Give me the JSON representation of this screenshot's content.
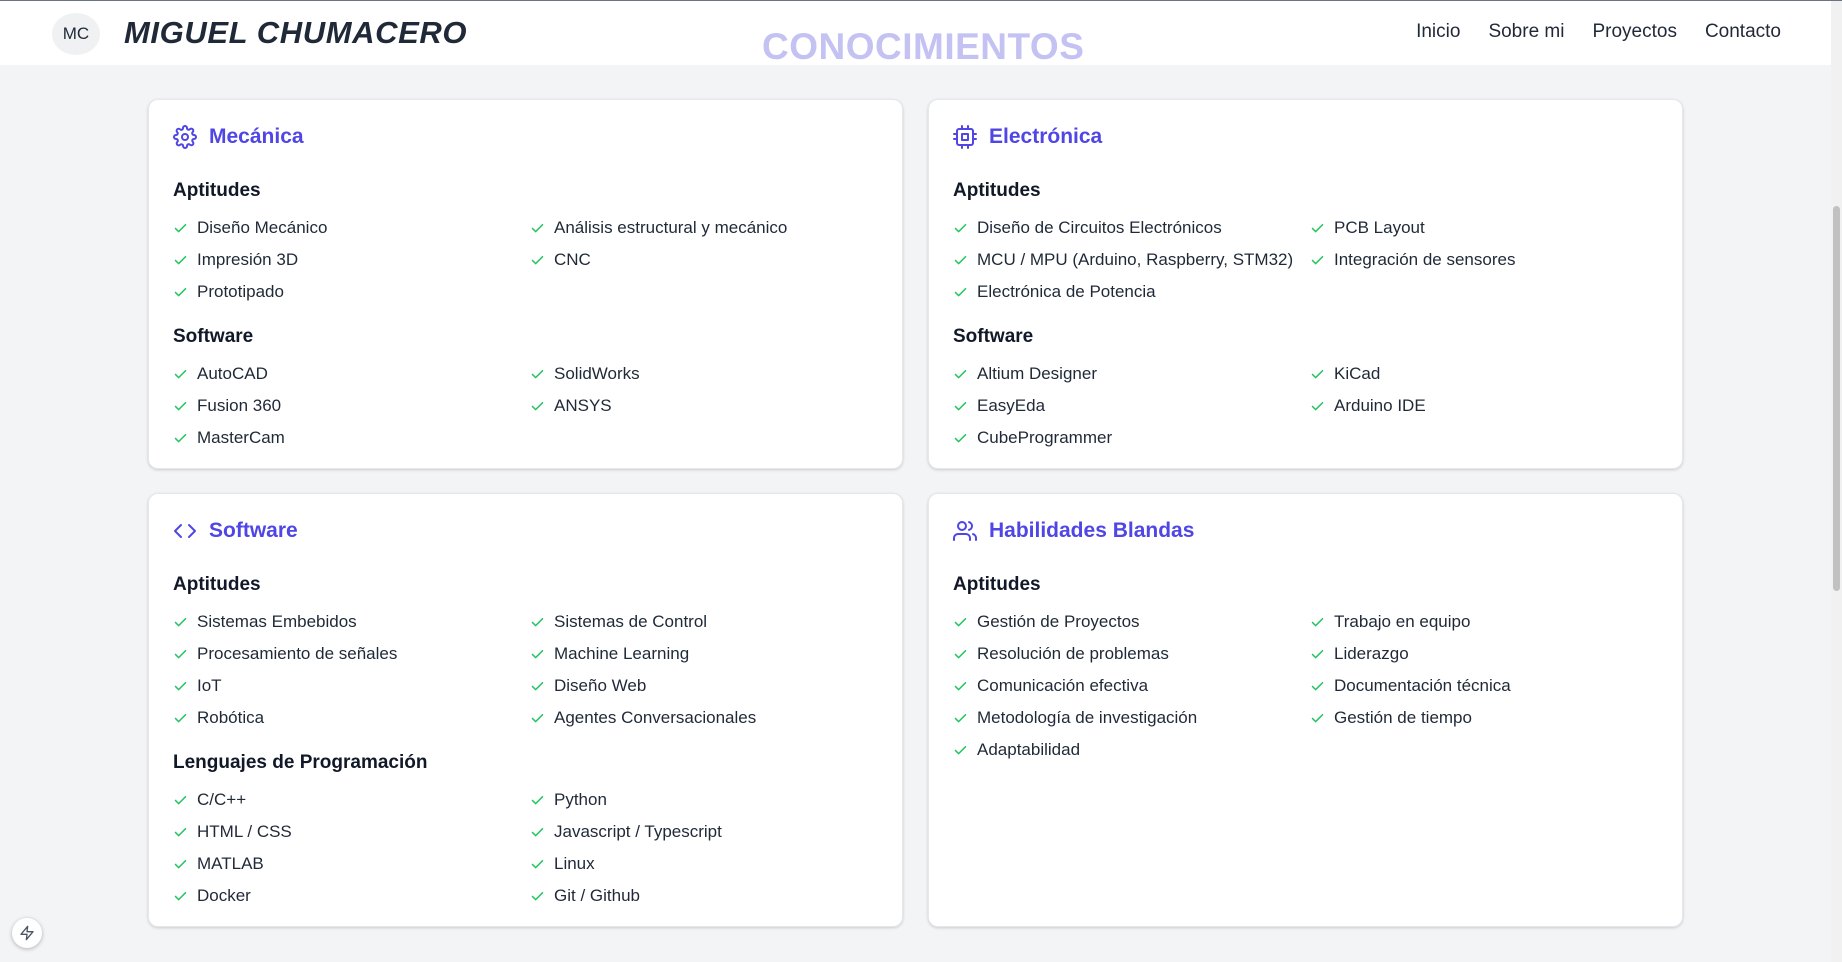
{
  "header": {
    "avatar_initials": "MC",
    "brand": "MIGUEL CHUMACERO",
    "section_title": "CONOCIMIENTOS",
    "nav": [
      "Inicio",
      "Sobre mi",
      "Proyectos",
      "Contacto"
    ]
  },
  "colors": {
    "accent": "#4f46e5",
    "check": "#22c55e",
    "section_title": "#c4c2f2",
    "background": "#f3f4f6"
  },
  "cards": {
    "mecanica": {
      "title": "Mecánica",
      "icon": "gear-icon",
      "groups": [
        {
          "title": "Aptitudes",
          "items": [
            "Diseño Mecánico",
            "Análisis estructural y mecánico",
            "Impresión 3D",
            "CNC",
            "Prototipado"
          ]
        },
        {
          "title": "Software",
          "items": [
            "AutoCAD",
            "SolidWorks",
            "Fusion 360",
            "ANSYS",
            "MasterCam"
          ]
        }
      ]
    },
    "electronica": {
      "title": "Electrónica",
      "icon": "chip-icon",
      "groups": [
        {
          "title": "Aptitudes",
          "items": [
            "Diseño de Circuitos Electrónicos",
            "PCB Layout",
            "MCU / MPU (Arduino, Raspberry, STM32)",
            "Integración de sensores",
            "Electrónica de Potencia"
          ]
        },
        {
          "title": "Software",
          "items": [
            "Altium Designer",
            "KiCad",
            "EasyEda",
            "Arduino IDE",
            "CubeProgrammer"
          ]
        }
      ]
    },
    "software": {
      "title": "Software",
      "icon": "code-icon",
      "groups": [
        {
          "title": "Aptitudes",
          "items": [
            "Sistemas Embebidos",
            "Sistemas de Control",
            "Procesamiento de señales",
            "Machine Learning",
            "IoT",
            "Diseño Web",
            "Robótica",
            "Agentes Conversacionales"
          ]
        },
        {
          "title": "Lenguajes de Programación",
          "items": [
            "C/C++",
            "Python",
            "HTML / CSS",
            "Javascript / Typescript",
            "MATLAB",
            "Linux",
            "Docker",
            "Git / Github"
          ]
        }
      ]
    },
    "blandas": {
      "title": "Habilidades Blandas",
      "icon": "users-icon",
      "groups": [
        {
          "title": "Aptitudes",
          "items": [
            "Gestión de Proyectos",
            "Trabajo en equipo",
            "Resolución de problemas",
            "Liderazgo",
            "Comunicación efectiva",
            "Documentación técnica",
            "Metodología de investigación",
            "Gestión de tiempo",
            "Adaptabilidad"
          ]
        }
      ]
    }
  }
}
